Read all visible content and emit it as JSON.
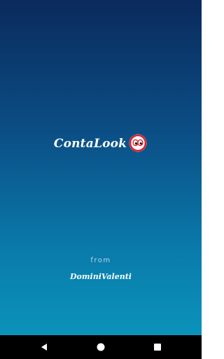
{
  "splash": {
    "app_name": "ContaLook",
    "from_label": "from",
    "developer": "DominiValenti"
  },
  "icons": {
    "logo": "eyes-badge-icon",
    "back": "back-triangle-icon",
    "home": "home-circle-icon",
    "recents": "recents-square-icon"
  },
  "colors": {
    "gradient_top": "#0a2a5c",
    "gradient_bottom": "#0a93bb",
    "badge_red": "#e0202a",
    "navbar": "#000000"
  }
}
